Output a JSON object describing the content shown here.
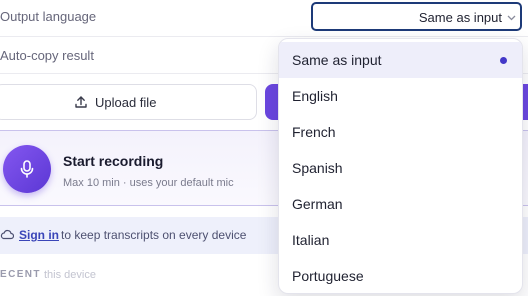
{
  "settings": {
    "output_language_label": "Output language",
    "output_language_value": "Same as input",
    "auto_copy_label": "Auto-copy result"
  },
  "actions": {
    "upload_label": "Upload file"
  },
  "record": {
    "title": "Start recording",
    "subtitle": "Max 10 min · uses your default mic"
  },
  "signin": {
    "link": "Sign in",
    "text": "to keep transcripts on every device"
  },
  "recent": {
    "label": "ECENT",
    "sublabel": "this device"
  },
  "dropdown": {
    "options": [
      "Same as input",
      "English",
      "French",
      "Spanish",
      "German",
      "Italian",
      "Portuguese"
    ],
    "selected": "Same as input"
  },
  "colors": {
    "accent": "#6b47e0",
    "selection_dot": "#4338c8",
    "select_border": "#1d3a78"
  },
  "icons": [
    "chevron-down-icon",
    "upload-icon",
    "microphone-icon",
    "cloud-icon"
  ]
}
